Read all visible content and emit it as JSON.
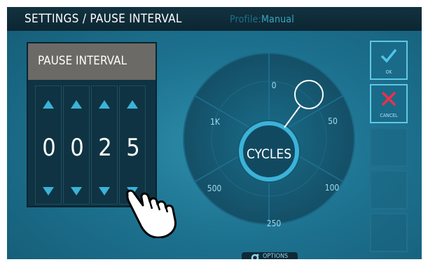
{
  "header": {
    "title": "SETTINGS / PAUSE INTERVAL",
    "profile_label": "Profile:",
    "profile_value": "Manual"
  },
  "panel": {
    "title": "PAUSE INTERVAL",
    "digits": [
      "0",
      "0",
      "2",
      "5"
    ]
  },
  "dial": {
    "center_label": "CYCLES",
    "labels": {
      "top": "0",
      "top_right": "50",
      "bottom_right": "100",
      "bottom": "250",
      "bottom_left": "500",
      "top_left": "1K"
    },
    "selected": "0"
  },
  "side_buttons": {
    "ok_label": "OK",
    "cancel_label": "CANCEL"
  },
  "options": {
    "label": "OPTIONS"
  },
  "colors": {
    "accent": "#3bb3d8",
    "cancel": "#e8324a",
    "ok": "#4fc4e8"
  }
}
